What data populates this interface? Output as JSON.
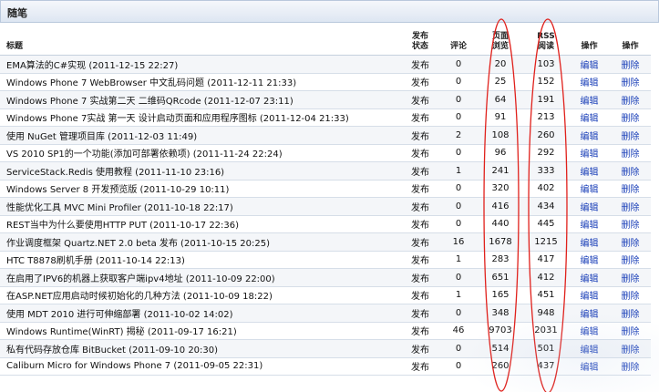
{
  "section": {
    "title": "随笔"
  },
  "columns": {
    "title": "标题",
    "status": [
      "发布",
      "状态"
    ],
    "comments": "评论",
    "views": [
      "页面",
      "浏览"
    ],
    "rss": [
      "RSS",
      "阅读"
    ],
    "edit": "操作",
    "delete": "操作"
  },
  "rows": [
    {
      "title": "EMA算法的C#实现 (2011-12-15 22:27)",
      "status": "发布",
      "comments": "0",
      "views": "20",
      "rss": "103",
      "edit": "编辑",
      "delete": "删除"
    },
    {
      "title": "Windows Phone 7 WebBrowser 中文乱码问题 (2011-12-11 21:33)",
      "status": "发布",
      "comments": "0",
      "views": "25",
      "rss": "152",
      "edit": "编辑",
      "delete": "删除"
    },
    {
      "title": "Windows Phone 7 实战第二天 二维码QRcode (2011-12-07 23:11)",
      "status": "发布",
      "comments": "0",
      "views": "64",
      "rss": "191",
      "edit": "编辑",
      "delete": "删除"
    },
    {
      "title": "Windows Phone 7实战 第一天 设计启动页面和应用程序图标 (2011-12-04 21:33)",
      "status": "发布",
      "comments": "0",
      "views": "91",
      "rss": "213",
      "edit": "编辑",
      "delete": "删除"
    },
    {
      "title": "使用 NuGet 管理项目库 (2011-12-03 11:49)",
      "status": "发布",
      "comments": "2",
      "views": "108",
      "rss": "260",
      "edit": "编辑",
      "delete": "删除"
    },
    {
      "title": "VS 2010 SP1的一个功能(添加可部署依赖项) (2011-11-24 22:24)",
      "status": "发布",
      "comments": "0",
      "views": "96",
      "rss": "292",
      "edit": "编辑",
      "delete": "删除"
    },
    {
      "title": "ServiceStack.Redis 使用教程 (2011-11-10 23:16)",
      "status": "发布",
      "comments": "1",
      "views": "241",
      "rss": "333",
      "edit": "编辑",
      "delete": "删除"
    },
    {
      "title": "Windows Server 8 开发预览版 (2011-10-29 10:11)",
      "status": "发布",
      "comments": "0",
      "views": "320",
      "rss": "402",
      "edit": "编辑",
      "delete": "删除"
    },
    {
      "title": "性能优化工具 MVC Mini Profiler (2011-10-18 22:17)",
      "status": "发布",
      "comments": "0",
      "views": "416",
      "rss": "434",
      "edit": "编辑",
      "delete": "删除"
    },
    {
      "title": "REST当中为什么要使用HTTP PUT (2011-10-17 22:36)",
      "status": "发布",
      "comments": "0",
      "views": "440",
      "rss": "445",
      "edit": "编辑",
      "delete": "删除"
    },
    {
      "title": "作业调度框架 Quartz.NET 2.0 beta 发布 (2011-10-15 20:25)",
      "status": "发布",
      "comments": "16",
      "views": "1678",
      "rss": "1215",
      "edit": "编辑",
      "delete": "删除"
    },
    {
      "title": "HTC T8878刷机手册 (2011-10-14 22:13)",
      "status": "发布",
      "comments": "1",
      "views": "283",
      "rss": "417",
      "edit": "编辑",
      "delete": "删除"
    },
    {
      "title": "在启用了IPV6的机器上获取客户端ipv4地址 (2011-10-09 22:00)",
      "status": "发布",
      "comments": "0",
      "views": "651",
      "rss": "412",
      "edit": "编辑",
      "delete": "删除"
    },
    {
      "title": "在ASP.NET应用启动时候初始化的几种方法 (2011-10-09 18:22)",
      "status": "发布",
      "comments": "1",
      "views": "165",
      "rss": "451",
      "edit": "编辑",
      "delete": "删除"
    },
    {
      "title": "使用 MDT 2010 进行可伸缩部署 (2011-10-02 14:02)",
      "status": "发布",
      "comments": "0",
      "views": "348",
      "rss": "948",
      "edit": "编辑",
      "delete": "删除"
    },
    {
      "title": "Windows Runtime(WinRT) 揭秘 (2011-09-17 16:21)",
      "status": "发布",
      "comments": "46",
      "views": "9703",
      "rss": "2031",
      "edit": "编辑",
      "delete": "删除"
    },
    {
      "title": "私有代码存放仓库 BitBucket (2011-09-10 20:30)",
      "status": "发布",
      "comments": "0",
      "views": "514",
      "rss": "501",
      "edit": "编辑",
      "delete": "删除"
    },
    {
      "title": "Caliburn Micro for Windows Phone 7 (2011-09-05 22:31)",
      "status": "发布",
      "comments": "0",
      "views": "260",
      "rss": "437",
      "edit": "编辑",
      "delete": "删除"
    }
  ],
  "annotation_color": "#e0201b"
}
